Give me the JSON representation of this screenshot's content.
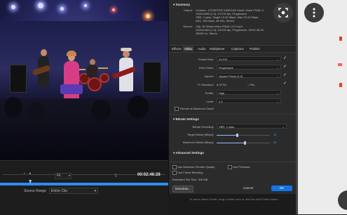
{
  "summary": {
    "heading": "Summary",
    "output_label": "Output:",
    "output_lines": [
      "/Volume...XSTARTER VIDEO/4K Music Video FINAL C",
      "1920x1080 (1.0), 23.976 fps, Progressive",
      "VBR, 2 pass, Target 10.00 Mbps, Max 20.00 Mbps",
      "AAC, 320 kbps, 48 kHz, Stereo"
    ],
    "source_label": "Source:",
    "source_lines": [
      "Clip, 4K Music Video FINAL CUT.mp4",
      "1920x1080 (1.0), 23.976 fps, Progressive, 00:02:46:28",
      "48000 Hz, Stereo"
    ]
  },
  "tabs": [
    "Effects",
    "Video",
    "Audio",
    "Multiplexer",
    "Captions",
    "Publish"
  ],
  "active_tab": "Video",
  "fields": {
    "frame_rate_label": "Frame Rate:",
    "frame_rate": "23.976",
    "field_order_label": "Field Order:",
    "field_order": "Progressive",
    "aspect_label": "Aspect:",
    "aspect": "Square Pixels (1.0)",
    "tv_standard_label": "TV Standard:",
    "ntsc": "NTSC",
    "pal": "PAL",
    "profile_label": "Profile:",
    "profile": "High",
    "level_label": "Level:",
    "level": "4.2",
    "render_max_depth": "Render at Maximum Depth"
  },
  "bitrate": {
    "heading": "Bitrate Settings",
    "encoding_label": "Bitrate Encoding:",
    "encoding": "VBR, 2 pass",
    "target_label": "Target Bitrate [Mbps]:",
    "target_value": "10",
    "max_label": "Maximum Bitrate [Mbps]:",
    "max_value": "20",
    "target_fraction": 0.38,
    "max_fraction": 0.52
  },
  "advanced": {
    "heading": "Advanced Settings"
  },
  "options": {
    "max_render_quality": "Use Maximum Render Quality",
    "use_previews": "Use Previews",
    "frame_blending": "Use Frame Blending",
    "file_size": "Estimated File Size: 326 MB"
  },
  "buttons": {
    "metadata": "Metadata...",
    "cancel": "Cancel",
    "ok": "OK"
  },
  "timeline": {
    "fit": "Fit",
    "timecode": "00:02:46:28",
    "source_range_label": "Source Range",
    "source_range": "Entire Clip",
    "playhead_fraction": 0.18
  },
  "watch_folder_text": "To add a Watch Folder, drag a folder here or click the Add Folder button.",
  "colors": {
    "accent": "#2d8ceb",
    "ok_button": "#1473e6",
    "bitrate_value": "#3d9dff"
  },
  "icons": [
    "lens-icon",
    "more-vert-icon",
    "play-icon",
    "marker-icon"
  ]
}
